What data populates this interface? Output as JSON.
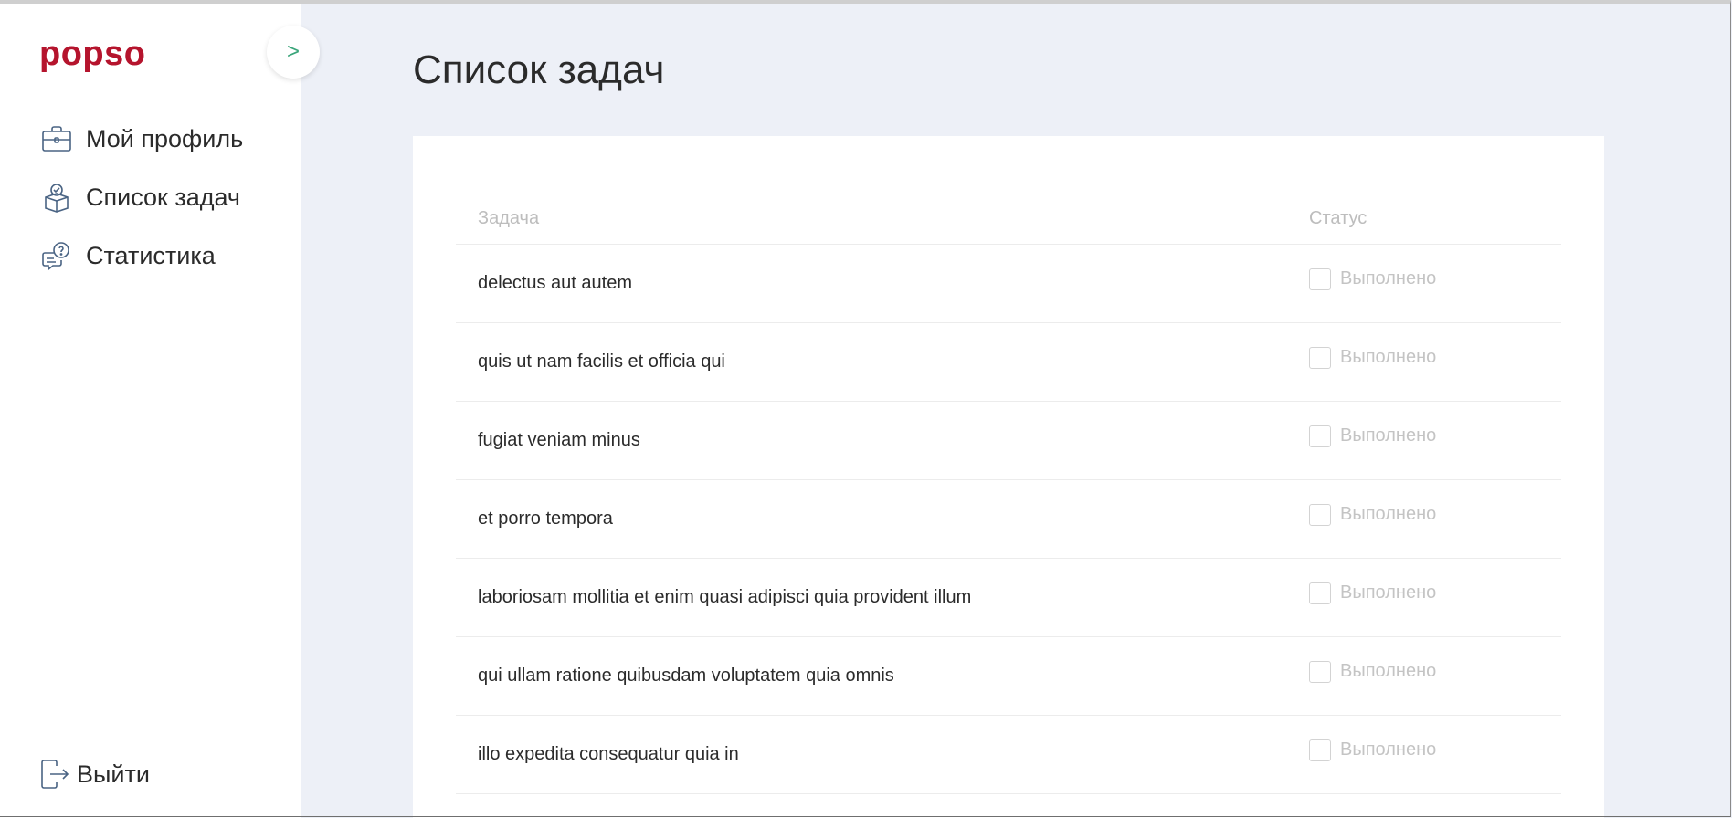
{
  "colors": {
    "brand": "#b5142d",
    "accent": "#3aa57a",
    "icon_stroke": "#4a6484",
    "main_bg": "#edf0f7"
  },
  "sidebar": {
    "logo": "popso",
    "collapse_label": ">",
    "items": [
      {
        "label": "Мой профиль",
        "icon": "briefcase-icon"
      },
      {
        "label": "Список задач",
        "icon": "clipboard-check-icon"
      },
      {
        "label": "Статистика",
        "icon": "question-chat-icon"
      }
    ],
    "logout": {
      "label": "Выйти",
      "icon": "logout-icon"
    }
  },
  "main": {
    "title": "Список задач",
    "table": {
      "headers": {
        "task": "Задача",
        "status": "Статус"
      },
      "status_label": "Выполнено",
      "rows": [
        {
          "task": "delectus aut autem",
          "done": false
        },
        {
          "task": "quis ut nam facilis et officia qui",
          "done": false
        },
        {
          "task": "fugiat veniam minus",
          "done": false
        },
        {
          "task": "et porro tempora",
          "done": false
        },
        {
          "task": "laboriosam mollitia et enim quasi adipisci quia provident illum",
          "done": false
        },
        {
          "task": "qui ullam ratione quibusdam voluptatem quia omnis",
          "done": false
        },
        {
          "task": "illo expedita consequatur quia in",
          "done": false
        }
      ]
    }
  }
}
